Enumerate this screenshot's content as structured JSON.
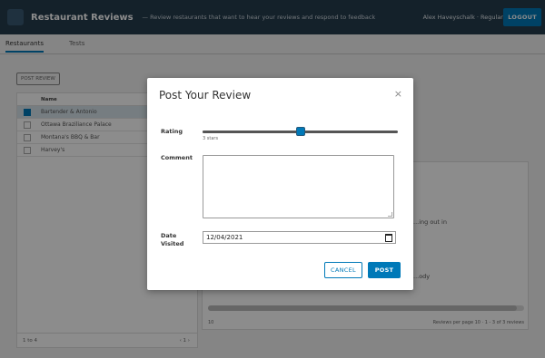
{
  "header": {
    "title": "Restaurant Reviews",
    "subtitle": "— Review restaurants that want to hear your reviews and respond to feedback",
    "user": "Alex Haveyschalk · Regular",
    "logout_label": "LOGOUT"
  },
  "tabs": [
    {
      "label": "Restaurants"
    },
    {
      "label": "Tests"
    }
  ],
  "list": {
    "post_review_label": "POST REVIEW",
    "column_name": "Name",
    "rows": [
      {
        "label": "Bartender & Antonio"
      },
      {
        "label": "Ottawa Braziliance Palace"
      },
      {
        "label": "Montana's BBQ & Bar"
      },
      {
        "label": "Harvey's"
      }
    ],
    "footer_count": "1 to 4",
    "pager": "‹  1  ›"
  },
  "detail": {
    "text_1": "...ing out in",
    "text_2": "...ody",
    "footer_left": "10",
    "footer_right": "Reviews per page  10  ·  1 - 3 of 3 reviews"
  },
  "modal": {
    "title": "Post Your Review",
    "close_glyph": "×",
    "rating_label": "Rating",
    "rating_value": 0.5,
    "rating_helper": "3 stars",
    "comment_label": "Comment",
    "comment_value": "",
    "date_label": "Date Visited",
    "date_value": "12/04/2021",
    "cancel_label": "CANCEL",
    "post_label": "POST"
  },
  "colors": {
    "primary": "#0079b8",
    "header_bg": "#253c4e"
  },
  "icons": {
    "close": "close-icon",
    "calendar": "calendar-icon"
  }
}
